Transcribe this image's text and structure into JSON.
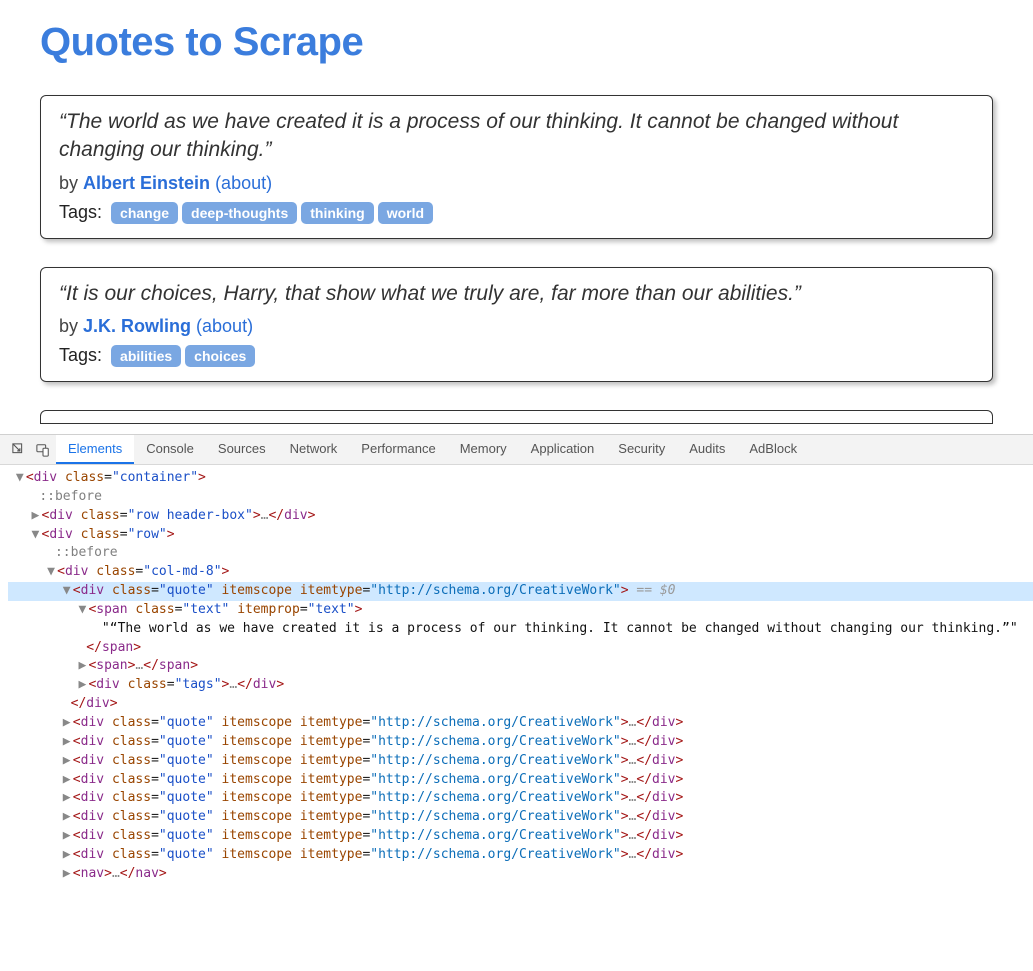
{
  "header": {
    "title": "Quotes to Scrape"
  },
  "by_label": "by",
  "tags_label": "Tags:",
  "about_label": "(about)",
  "quotes": [
    {
      "text": "“The world as we have created it is a process of our thinking. It cannot be changed without changing our thinking.”",
      "author": "Albert Einstein",
      "tags": [
        "change",
        "deep-thoughts",
        "thinking",
        "world"
      ]
    },
    {
      "text": "“It is our choices, Harry, that show what we truly are, far more than our abilities.”",
      "author": "J.K. Rowling",
      "tags": [
        "abilities",
        "choices"
      ]
    }
  ],
  "devtools": {
    "tabs": [
      "Elements",
      "Console",
      "Sources",
      "Network",
      "Performance",
      "Memory",
      "Application",
      "Security",
      "Audits",
      "AdBlock"
    ],
    "active_tab": "Elements",
    "container_line": {
      "class": "container"
    },
    "pseudo": "::before",
    "header_row": {
      "class": "row header-box"
    },
    "row": {
      "class": "row"
    },
    "col": {
      "class": "col-md-8"
    },
    "selected_quote": {
      "class": "quote",
      "itemscope": "itemscope",
      "itemtype": "http://schema.org/CreativeWork",
      "eq": "== $0"
    },
    "span_text": {
      "class": "text",
      "itemprop": "text",
      "content": "\"“The world as we have created it is a process of our thinking. It cannot be changed without changing our thinking.”\""
    },
    "tags_div": {
      "class": "tags"
    },
    "repeat_quote": {
      "class": "quote",
      "itemscope": "itemscope",
      "itemtype": "http://schema.org/CreativeWork",
      "count": 8
    },
    "nav": "nav"
  }
}
